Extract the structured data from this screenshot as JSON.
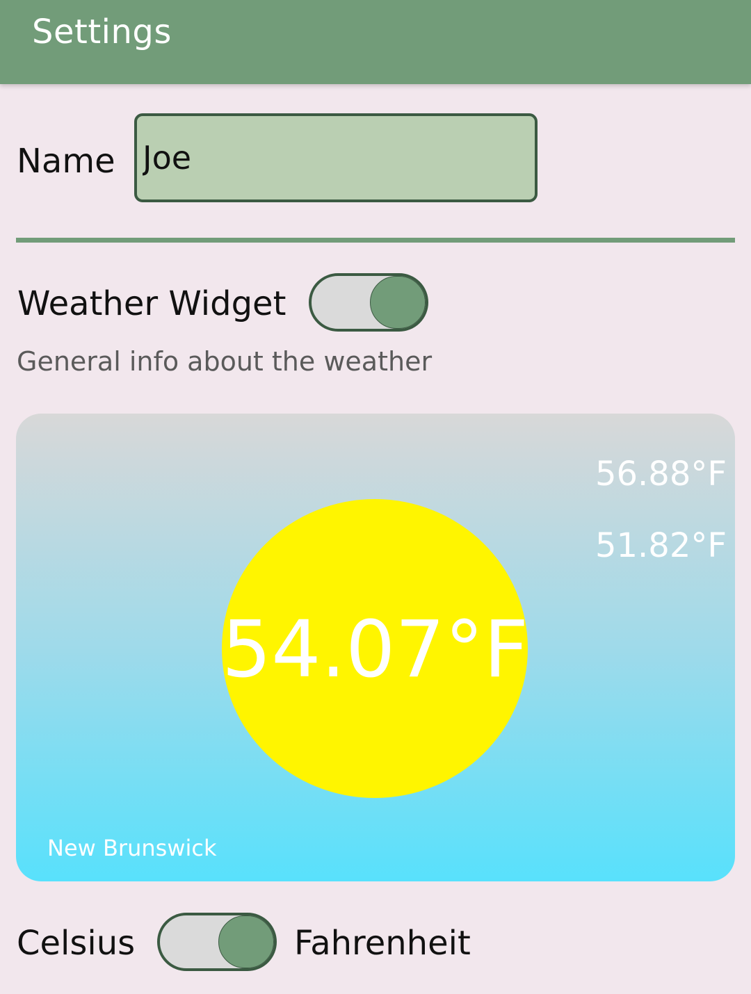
{
  "app_bar": {
    "title": "Settings"
  },
  "name_field": {
    "label": "Name",
    "value": "Joe"
  },
  "weather_widget": {
    "label": "Weather Widget",
    "description": "General info about the weather",
    "enabled": true
  },
  "weather_card": {
    "current_temp": "54.07°F",
    "high_temp": "56.88°F",
    "low_temp": "51.82°F",
    "location": "New Brunswick",
    "icon": "sun-icon"
  },
  "units": {
    "left_label": "Celsius",
    "right_label": "Fahrenheit",
    "selected": "Fahrenheit"
  },
  "colors": {
    "accent": "#729c79",
    "accent_dark": "#3b5a42",
    "background": "#f2e7ed",
    "input_fill": "#bacfb2",
    "sun": "#fff500",
    "sky_bottom": "#58e1fc"
  }
}
